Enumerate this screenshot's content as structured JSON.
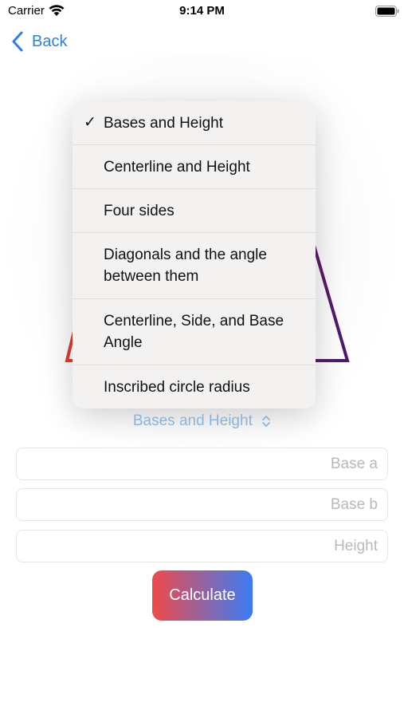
{
  "status_bar": {
    "carrier": "Carrier",
    "time": "9:14 PM"
  },
  "nav": {
    "back_label": "Back"
  },
  "menu": {
    "items": [
      {
        "label": "Bases and Height",
        "selected": true
      },
      {
        "label": "Centerline and Height",
        "selected": false
      },
      {
        "label": "Four sides",
        "selected": false
      },
      {
        "label": "Diagonals and the angle between them",
        "selected": false
      },
      {
        "label": "Centerline, Side, and Base Angle",
        "selected": false
      },
      {
        "label": "Inscribed circle radius",
        "selected": false
      }
    ]
  },
  "picker": {
    "selected": "Bases and Height"
  },
  "fields": {
    "base_a": {
      "placeholder": "Base a",
      "value": ""
    },
    "base_b": {
      "placeholder": "Base b",
      "value": ""
    },
    "height": {
      "placeholder": "Height",
      "value": ""
    }
  },
  "calculate": {
    "label": "Calculate"
  },
  "colors": {
    "accent": "#2f7fe0",
    "picker_text": "#8ab3de",
    "gradient_start": "#f04a4a",
    "gradient_end": "#3a7cf5",
    "shape_left": "#e23b2a",
    "shape_right": "#4a1a6e"
  }
}
